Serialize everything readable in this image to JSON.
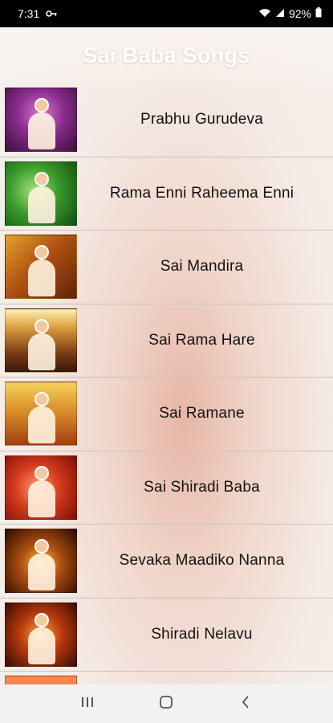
{
  "status_bar": {
    "time": "7:31",
    "battery": "92%"
  },
  "header": {
    "title": "Sai Baba Songs"
  },
  "songs": [
    {
      "title": "Prabhu Gurudeva"
    },
    {
      "title": "Rama Enni Raheema Enni"
    },
    {
      "title": "Sai Mandira"
    },
    {
      "title": "Sai Rama Hare"
    },
    {
      "title": "Sai Ramane"
    },
    {
      "title": "Sai Shiradi Baba"
    },
    {
      "title": "Sevaka Maadiko Nanna"
    },
    {
      "title": "Shiradi Nelavu"
    }
  ],
  "icons": {
    "key": "key-icon",
    "wifi": "wifi-icon",
    "signal": "signal-icon",
    "battery": "battery-icon",
    "recents": "recents-icon",
    "home": "home-icon",
    "back": "back-icon"
  },
  "colors": {
    "header_text": "#ffffff",
    "list_text": "#111111",
    "status_bg": "#000000",
    "nav_bg": "#f2f2f2"
  }
}
